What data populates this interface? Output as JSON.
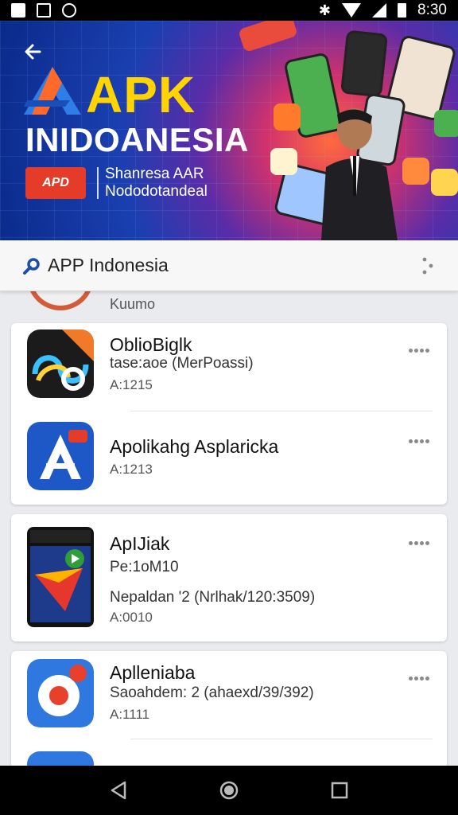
{
  "status_bar": {
    "time": "8:30"
  },
  "banner": {
    "brand_title": "APK",
    "brand_subtitle": "INIDOANESIA",
    "badge_text": "APD",
    "tagline_line1": "Shanresa AAR",
    "tagline_line2": "Nododotandeal"
  },
  "search_bar": {
    "title": "APP Indonesia"
  },
  "peek_item": {
    "version": "Kuumo"
  },
  "apps": [
    {
      "name": "OblioBiglk",
      "line": "tase:aoe (MerPoassi)",
      "version": "A:1215",
      "icon": "infinity-app-icon",
      "accent": "#f07a2a"
    },
    {
      "name": "Apolikahg Asplaricka",
      "line": "",
      "version": "A:1213",
      "icon": "letter-a-app-icon",
      "accent": "#1e58c6"
    },
    {
      "name": "ApIJiak",
      "line": "Pe:1oM10",
      "line2": "Nepaldan '2 (Nrlhak/120:3509)",
      "version": "A:0010",
      "icon": "play-app-icon",
      "accent": "#2f9d3a"
    },
    {
      "name": "Aplleniaba",
      "line": "Saoahdem: 2 (ahaexd/39/392)",
      "version": "A:1111",
      "icon": "camera-app-icon",
      "accent": "#e8402c"
    }
  ],
  "colors": {
    "banner_blue": "#1a3fb0",
    "brand_yellow": "#ffd400",
    "badge_red": "#e53c2a"
  }
}
